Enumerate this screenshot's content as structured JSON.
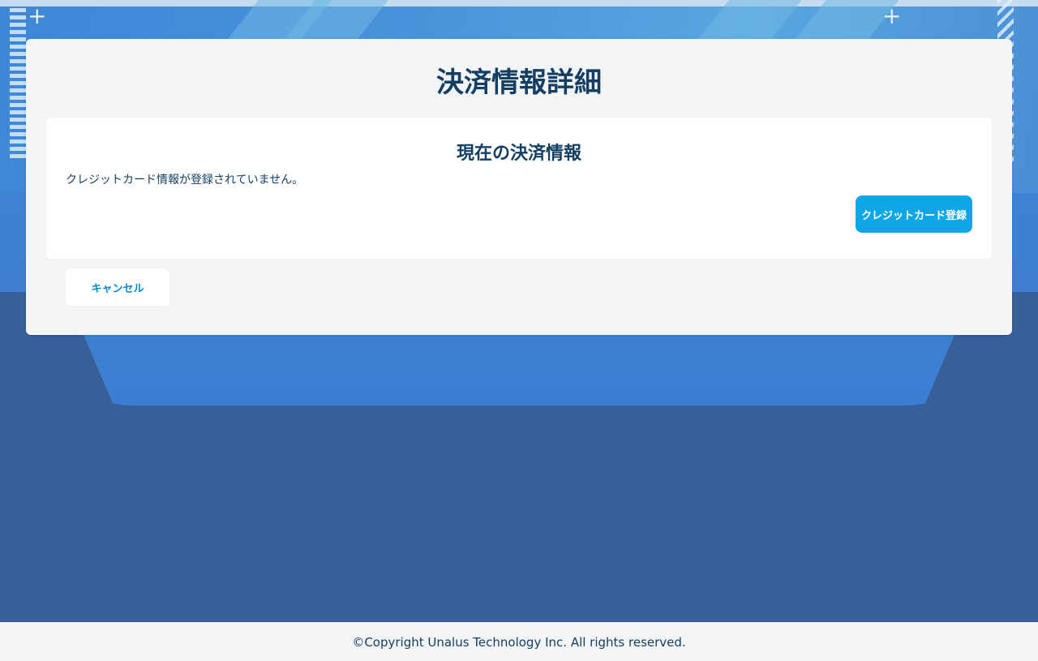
{
  "page": {
    "title": "決済情報詳細"
  },
  "payment_card": {
    "title": "現在の決済情報",
    "message": "クレジットカード情報が登録されていません。",
    "register_button_label": "クレジットカード登録"
  },
  "actions": {
    "cancel_label": "キャンセル"
  },
  "footer": {
    "copyright": "©Copyright Unalus Technology Inc. All rights reserved."
  },
  "colors": {
    "accent": "#0ea6e6",
    "heading": "#143f63",
    "background_dark": "#385f98",
    "panel": "#f2f4f6"
  }
}
